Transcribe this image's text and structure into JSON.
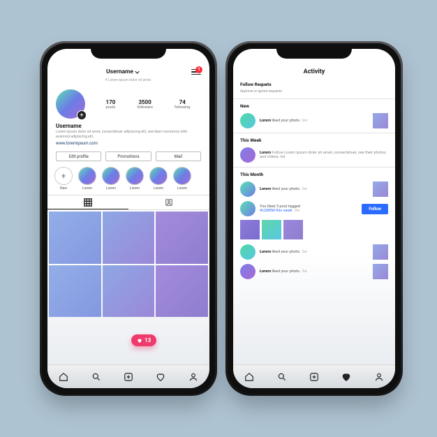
{
  "left": {
    "username_header": "Username",
    "header_sub": "4 Lorem ipsum dolor sit amet.",
    "menu_badge": "1",
    "stats": {
      "posts_n": "170",
      "posts_l": "posts",
      "followers_n": "3500",
      "followers_l": "followers",
      "following_n": "74",
      "following_l": "following"
    },
    "bio_name": "Username",
    "bio_desc": "Lorem ipsum dolor sit amet, consectetuer adipiscing elit, sed diam nonummy nibh euismod adipiscing elit.",
    "bio_link": "www.loremipsum.com",
    "buttons": {
      "edit": "Edit profile",
      "promo": "Promotions",
      "mail": "Mail"
    },
    "highlights": {
      "new": "New",
      "l1": "Lorem",
      "l2": "Lorem",
      "l3": "Lorem",
      "l4": "Lorem",
      "l5": "Lorem"
    },
    "like_bubble": "13"
  },
  "right": {
    "title": "Activity",
    "follow_req": "Follow Requets",
    "follow_req_sub": "Approve or ignore requests",
    "sec_new": "New",
    "sec_week": "This Week",
    "sec_month": "This Month",
    "r1_user": "Lorem",
    "r1_text": " liked your photo.",
    "r1_time": "6m",
    "r2_user": "Lorem",
    "r2_text": " Follow Lorem ipsum dolor sit amet, consectetuer, see their photos and videos. 6d",
    "r3_user": "Lorem",
    "r3_text": " liked your photo.",
    "r3_time": "2w",
    "tagged_line": "You liked 3 post tagged",
    "tagged_hash": "#LOREM this week ",
    "tagged_time": "2w",
    "follow_btn": "Follow",
    "r4_user": "Lorem",
    "r4_text": " liked your photo.",
    "r4_time": "3w",
    "r5_user": "Lorem",
    "r5_text": " liked your photo.",
    "r5_time": "3w"
  }
}
